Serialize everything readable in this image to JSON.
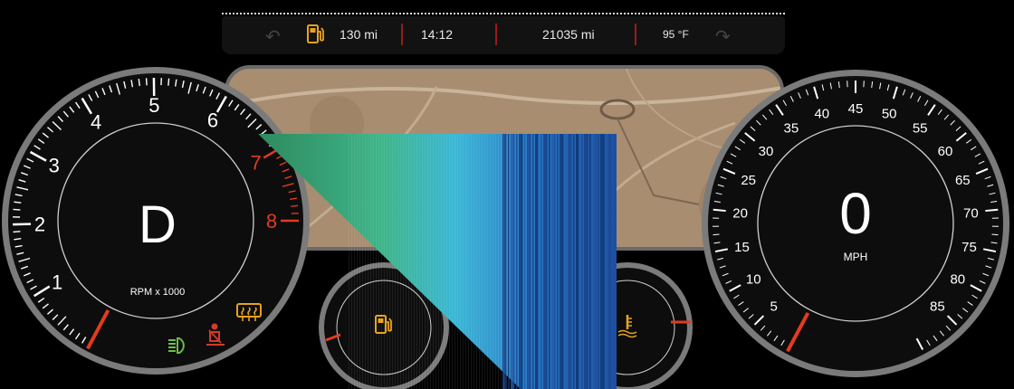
{
  "topbar": {
    "range": "130 mi",
    "time": "14:12",
    "odometer": "21035 mi",
    "temperature": "95 °F"
  },
  "tachometer": {
    "gear": "D",
    "unit_label": "RPM x 1000",
    "ticks": [
      "1",
      "2",
      "3",
      "4",
      "5",
      "6",
      "7",
      "8"
    ],
    "redline_from": 7,
    "value_rpm_x1000": 0
  },
  "speedometer": {
    "speed": "0",
    "unit": "MPH",
    "ticks": [
      "5",
      "10",
      "15",
      "20",
      "25",
      "30",
      "35",
      "40",
      "45",
      "50",
      "55",
      "60",
      "65",
      "70",
      "75",
      "80",
      "85"
    ],
    "value_mph": 0
  },
  "fuel_gauge": {
    "icon": "fuel-pump-icon"
  },
  "coolant_gauge": {
    "icon": "coolant-temp-icon"
  },
  "warning_lights": {
    "headlight": {
      "icon": "headlight-icon",
      "color": "#6dbf4b"
    },
    "seatbelt": {
      "icon": "seatbelt-icon",
      "color": "#d23a2a"
    },
    "defrost": {
      "icon": "rear-defrost-icon",
      "color": "#e8a21d"
    }
  },
  "colors": {
    "accent_red": "#e23b1e",
    "amber": "#e8a21d",
    "green": "#6dbf4b",
    "bezel": "#6a6a6a"
  }
}
